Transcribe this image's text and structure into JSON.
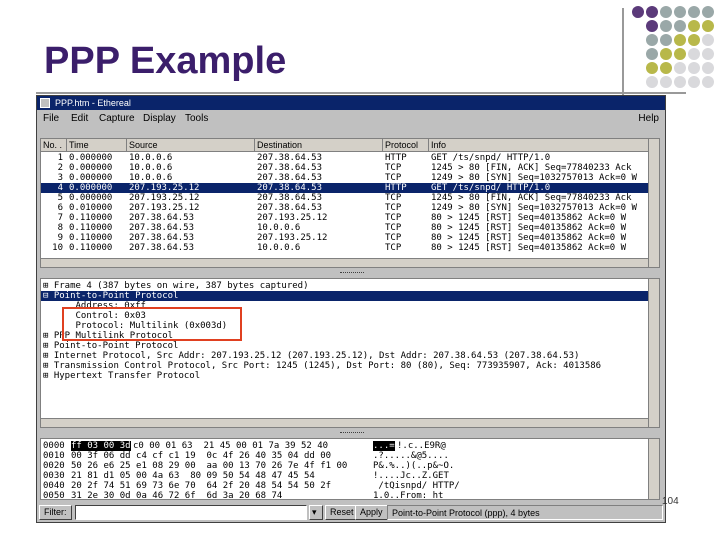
{
  "slide": {
    "title": "PPP Example",
    "page_number": "104"
  },
  "window": {
    "title": "PPP.htm - Ethereal",
    "menu": [
      "File",
      "Edit",
      "Capture",
      "Display",
      "Tools"
    ],
    "menu_help": "Help"
  },
  "packet_list": {
    "columns": [
      "No. .",
      "Time",
      "Source",
      "Destination",
      "Protocol",
      "Info"
    ],
    "rows": [
      {
        "no": "1",
        "time": "0.000000",
        "src": "10.0.0.6",
        "dst": "207.38.64.53",
        "proto": "HTTP",
        "info": "GET /ts/snpd/ HTTP/1.0"
      },
      {
        "no": "2",
        "time": "0.000000",
        "src": "10.0.0.6",
        "dst": "207.38.64.53",
        "proto": "TCP",
        "info": "1245 > 80 [FIN, ACK] Seq=77840233 Ack"
      },
      {
        "no": "3",
        "time": "0.000000",
        "src": "10.0.0.6",
        "dst": "207.38.64.53",
        "proto": "TCP",
        "info": "1249 > 80 [SYN] Seq=1032757013 Ack=0 W"
      },
      {
        "no": "4",
        "time": "0.000000",
        "src": "207.193.25.12",
        "dst": "207.38.64.53",
        "proto": "HTTP",
        "info": "GET /ts/snpd/ HTTP/1.0"
      },
      {
        "no": "5",
        "time": "0.000000",
        "src": "207.193.25.12",
        "dst": "207.38.64.53",
        "proto": "TCP",
        "info": "1245 > 80 [FIN, ACK] Seq=77840233 Ack"
      },
      {
        "no": "6",
        "time": "0.010000",
        "src": "207.193.25.12",
        "dst": "207.38.64.53",
        "proto": "TCP",
        "info": "1249 > 80 [SYN] Seq=1032757013 Ack=0 W"
      },
      {
        "no": "7",
        "time": "0.110000",
        "src": "207.38.64.53",
        "dst": "207.193.25.12",
        "proto": "TCP",
        "info": "80 > 1245 [RST] Seq=40135862 Ack=0 W"
      },
      {
        "no": "8",
        "time": "0.110000",
        "src": "207.38.64.53",
        "dst": "10.0.0.6",
        "proto": "TCP",
        "info": "80 > 1245 [RST] Seq=40135862 Ack=0 W"
      },
      {
        "no": "9",
        "time": "0.110000",
        "src": "207.38.64.53",
        "dst": "207.193.25.12",
        "proto": "TCP",
        "info": "80 > 1245 [RST] Seq=40135862 Ack=0 W"
      },
      {
        "no": "10",
        "time": "0.110000",
        "src": "207.38.64.53",
        "dst": "10.0.0.6",
        "proto": "TCP",
        "info": "80 > 1245 [RST] Seq=40135862 Ack=0 W"
      }
    ],
    "selected_index": 3
  },
  "details": {
    "rows": [
      "⊞ Frame 4 (387 bytes on wire, 387 bytes captured)",
      "⊟ Point-to-Point Protocol",
      "      Address: 0xff",
      "      Control: 0x03",
      "      Protocol: Multilink (0x003d)",
      "⊞ PPP Multilink Protocol",
      "⊞ Point-to-Point Protocol",
      "⊞ Internet Protocol, Src Addr: 207.193.25.12 (207.193.25.12), Dst Addr: 207.38.64.53 (207.38.64.53)",
      "⊞ Transmission Control Protocol, Src Port: 1245 (1245), Dst Port: 80 (80), Seq: 773935907, Ack: 4013586",
      "⊞ Hypertext Transfer Protocol"
    ],
    "selected_index": 1
  },
  "hex": {
    "rows": [
      {
        "off": "0000",
        "hl": "ff 03 00 3d",
        "bytes": "c0 00 01 63  21 45 00 01 7a 39 52 40",
        "ascii_hl": "...=",
        "ascii": "!.c..E9R@"
      },
      {
        "off": "0010",
        "hl": "",
        "bytes": "00 3f 06 dd c4 cf c1 19  0c 4f 26 40 35 04 dd 00",
        "ascii_hl": "",
        "ascii": ".?.....&@5...."
      },
      {
        "off": "0020",
        "hl": "",
        "bytes": "50 26 e6 25 e1 08 29 00  aa 00 13 70 26 7e 4f f1 00",
        "ascii_hl": "",
        "ascii": "P&.%..)(..p&~O."
      },
      {
        "off": "0030",
        "hl": "",
        "bytes": "21 81 d1 05 00 4a 63  80 09 50 54 48 47 45 54",
        "ascii_hl": "",
        "ascii": "!....Jc..Z.GET"
      },
      {
        "off": "0040",
        "hl": "",
        "bytes": "20 2f 74 51 69 73 6e 70  64 2f 20 48 54 54 50 2f",
        "ascii_hl": "",
        "ascii": " /tQisnpd/ HTTP/"
      },
      {
        "off": "0050",
        "hl": "",
        "bytes": "31 2e 30 0d 0a 46 72 6f  6d 3a 20 68 74",
        "ascii_hl": "",
        "ascii": "1.0..From: ht"
      }
    ]
  },
  "status": {
    "filter_label": "Filter:",
    "reset_label": "Reset",
    "apply_label": "Apply",
    "message": "Point-to-Point Protocol (ppp), 4 bytes"
  },
  "colors": {
    "title": "#3b1e6b",
    "selection": "#0a246a",
    "highlight_box": "#e04020"
  }
}
